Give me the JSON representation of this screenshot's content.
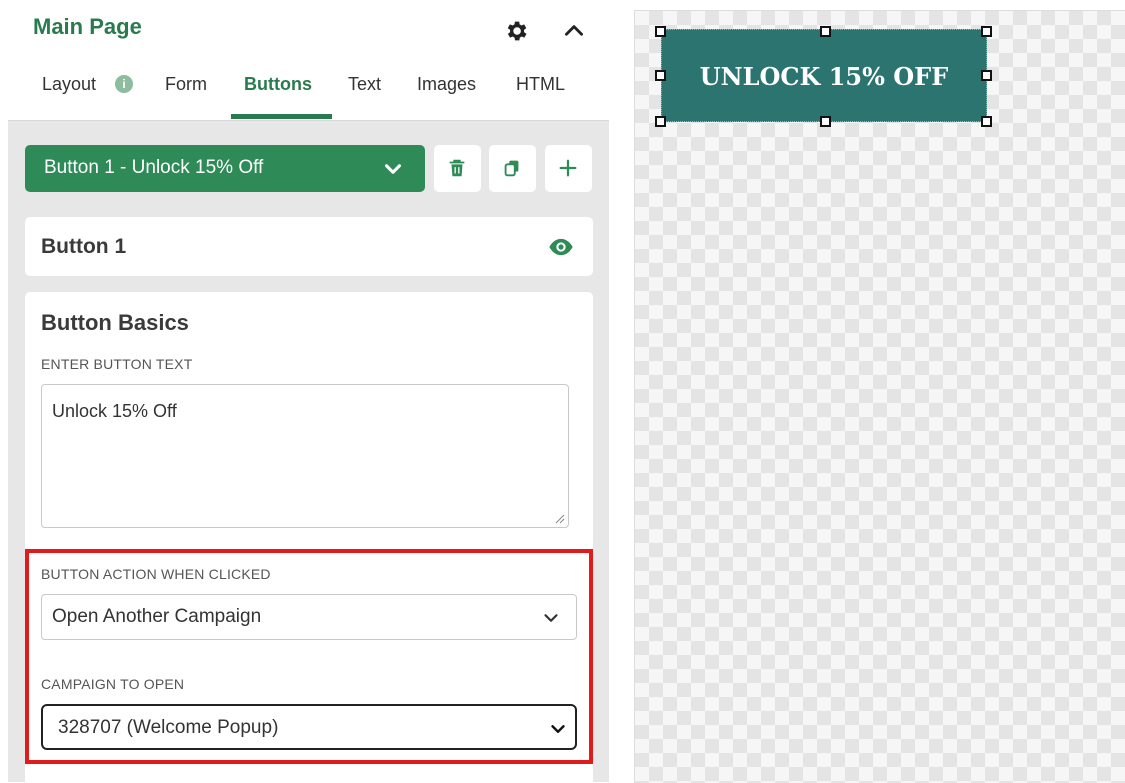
{
  "panel": {
    "title": "Main Page",
    "tabs": [
      {
        "label": "Layout",
        "active": false
      },
      {
        "label": "Form",
        "active": false
      },
      {
        "label": "Buttons",
        "active": true
      },
      {
        "label": "Text",
        "active": false
      },
      {
        "label": "Images",
        "active": false
      },
      {
        "label": "HTML",
        "active": false
      }
    ],
    "layout_info_badge": "i",
    "icons": {
      "settings": "gear-icon",
      "collapse": "chevron-up-icon"
    }
  },
  "button_selector": {
    "selected": "Button 1 - Unlock 15% Off",
    "actions": [
      "trash-icon",
      "copy-icon",
      "plus-icon"
    ]
  },
  "button_card": {
    "name": "Button 1",
    "visibility_icon": "eye-icon"
  },
  "basics": {
    "heading": "Button Basics",
    "text_label": "ENTER BUTTON TEXT",
    "text_value": "Unlock 15% Off",
    "action_label": "BUTTON ACTION WHEN CLICKED",
    "action_value": "Open Another Campaign",
    "campaign_label": "CAMPAIGN TO OPEN",
    "campaign_value": "328707 (Welcome Popup)"
  },
  "preview": {
    "button_text": "UNLOCK 15% OFF",
    "button_color": "#2b7470"
  },
  "colors": {
    "brand_green": "#2a7a4f",
    "selector_green": "#2e8a57",
    "highlight_red": "#e01b1b"
  }
}
